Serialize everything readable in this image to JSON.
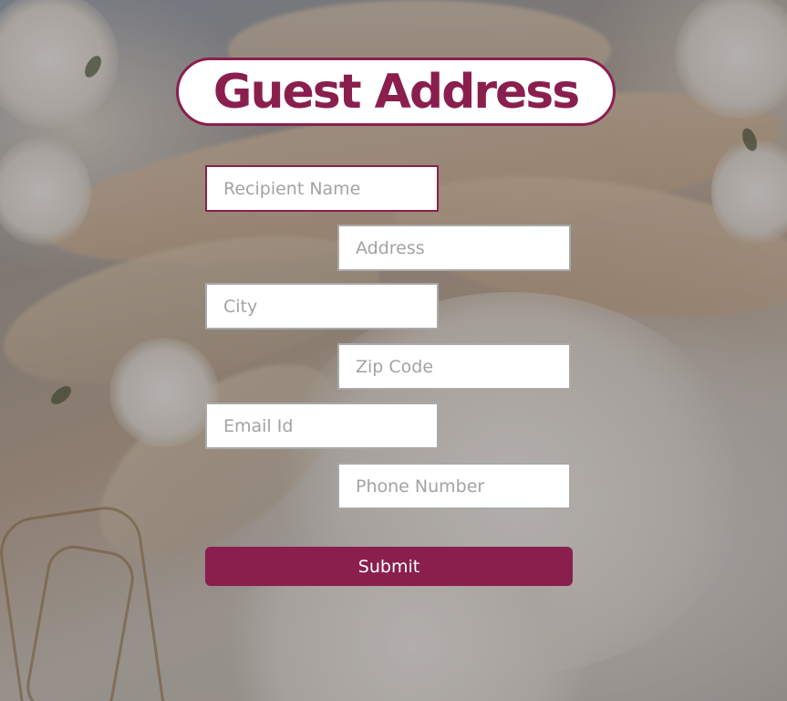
{
  "form": {
    "title": "Guest Address",
    "fields": {
      "recipient_name": {
        "placeholder": "Recipient Name",
        "value": ""
      },
      "address": {
        "placeholder": "Address",
        "value": ""
      },
      "city": {
        "placeholder": "City",
        "value": ""
      },
      "zip_code": {
        "placeholder": "Zip Code",
        "value": ""
      },
      "email": {
        "placeholder": "Email Id",
        "value": ""
      },
      "phone": {
        "placeholder": "Phone Number",
        "value": ""
      }
    },
    "submit_label": "Submit"
  },
  "colors": {
    "accent": "#8a1f4e",
    "field_border": "#a9a9a9",
    "placeholder": "#a3a3a3"
  }
}
